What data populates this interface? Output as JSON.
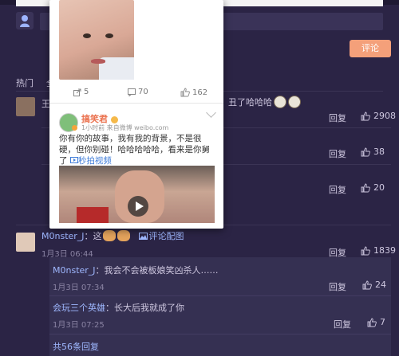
{
  "tabs": {
    "hot": "热门"
  },
  "compose": {
    "submit": "评论"
  },
  "comments": [
    {
      "prefix": "王",
      "text_tail": "丑了哈哈哈",
      "reply": "回复",
      "likes": "2908"
    },
    {
      "reply": "回复",
      "likes": "38"
    },
    {
      "reply": "回复",
      "likes": "20"
    },
    {
      "user": "M0nster_J",
      "sep": "：这",
      "img_link": "评论配图",
      "time": "1月3日 06:44",
      "reply": "回复",
      "likes": "1839"
    }
  ],
  "subreplies": [
    {
      "user": "M0nster_J",
      "text": "：我会不会被板娘笑凶杀人……",
      "time": "1月3日 07:34",
      "reply": "回复",
      "likes": "24"
    },
    {
      "user": "会玩三个英雄",
      "text": "：长大后我就成了你",
      "time": "1月3日 07:25",
      "reply": "回复",
      "likes": "7"
    }
  ],
  "more_replies": "共56条回复",
  "popup": {
    "stats": {
      "share": "5",
      "comments": "70",
      "likes": "162"
    },
    "author": "搞笑君",
    "time_source": "1小时前  来自微博 weibo.com",
    "text_main": "你有你的故事，我有我的背景，不是很硬，但你别碰！哈哈哈哈哈，看来是你舅了",
    "video_link": "秒拍视频"
  },
  "colors": {
    "background": "#2b2445",
    "accent": "#f4a07a",
    "name_orange": "#eb7350",
    "link_blue": "#3d7bd8"
  }
}
